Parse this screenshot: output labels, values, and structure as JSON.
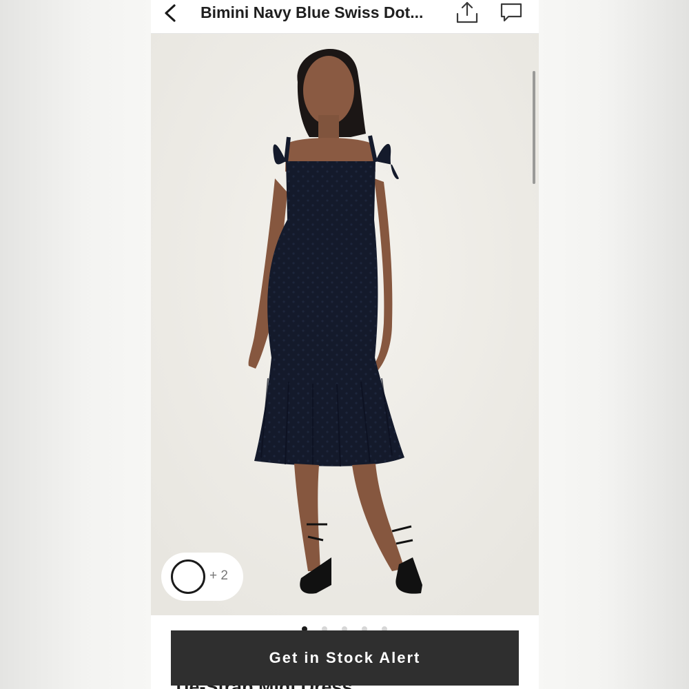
{
  "header": {
    "back_icon": "chevron-left-icon",
    "title": "Bimini Navy Blue Swiss Dot...",
    "share_icon": "share-upload-icon",
    "comment_icon": "comment-bubble-icon"
  },
  "gallery": {
    "image_alt_icon": "product-photo",
    "swatch_icon": "color-swatch-ring-icon",
    "swatch_more": "+ 2",
    "page_count": 5,
    "active_page": 1
  },
  "product": {
    "subtitle": "Tie-Strap Midi Dress"
  },
  "cta": {
    "label": "Get in Stock Alert"
  },
  "colors": {
    "dress": "#141a2b",
    "button": "#2f2f2f",
    "background": "#efeee9"
  }
}
